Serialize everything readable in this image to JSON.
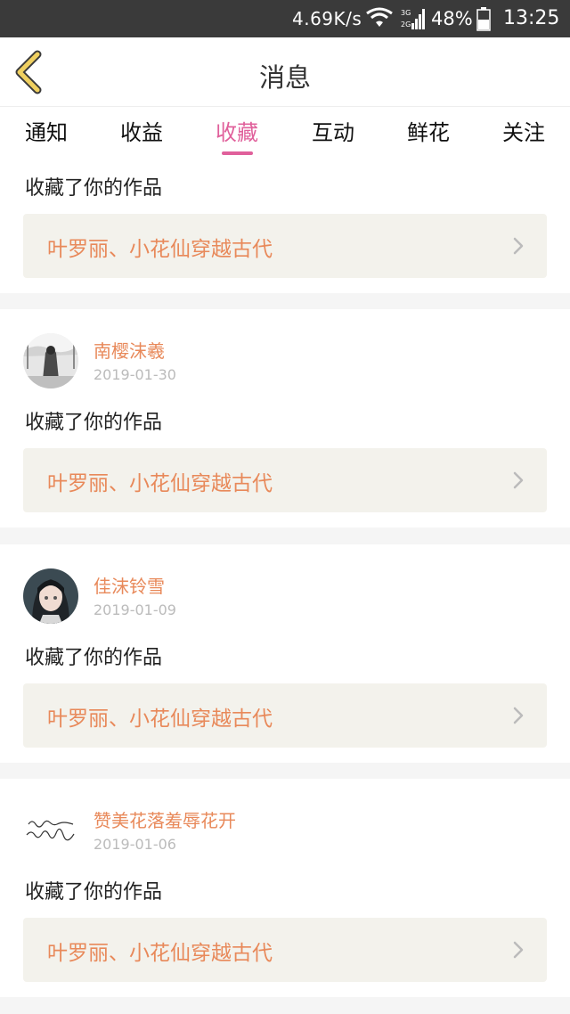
{
  "status_bar": {
    "net_speed": "4.69K/s",
    "battery_percent": "48%",
    "time": "13:25",
    "icons": [
      "wifi-icon",
      "signal-3g-icon",
      "battery-icon"
    ]
  },
  "header": {
    "title": "消息",
    "back_icon": "chevron-left-icon"
  },
  "tabs": [
    {
      "label": "通知"
    },
    {
      "label": "收益"
    },
    {
      "label": "收藏",
      "active": true
    },
    {
      "label": "互动"
    },
    {
      "label": "鲜花"
    },
    {
      "label": "关注"
    }
  ],
  "messages": [
    {
      "action": "收藏了你的作品",
      "work_title": "叶罗丽、小花仙穿越古代"
    },
    {
      "username": "南樱沫羲",
      "date": "2019-01-30",
      "action": "收藏了你的作品",
      "work_title": "叶罗丽、小花仙穿越古代"
    },
    {
      "username": "佳沫铃雪",
      "date": "2019-01-09",
      "action": "收藏了你的作品",
      "work_title": "叶罗丽、小花仙穿越古代"
    },
    {
      "username": "赞美花落羞辱花开",
      "date": "2019-01-06",
      "action": "收藏了你的作品",
      "work_title": "叶罗丽、小花仙穿越古代"
    }
  ],
  "colors": {
    "accent_pink": "#e0609b",
    "accent_orange": "#e8895a",
    "back_arrow": "#f0d060",
    "status_bar": "#3a3a3a"
  }
}
